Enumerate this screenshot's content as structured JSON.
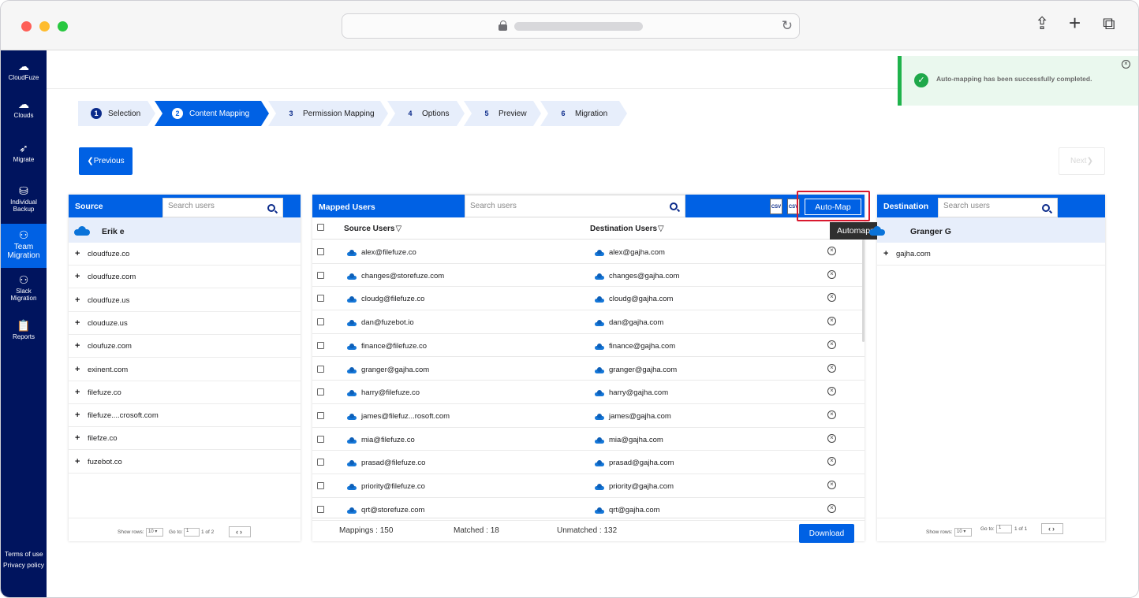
{
  "sidebar": {
    "brand": "CloudFuze",
    "items": [
      {
        "label": "Clouds",
        "icon": "cloud-icon"
      },
      {
        "label": "Migrate",
        "icon": "rocket-icon"
      },
      {
        "label_1": "Individual",
        "label_2": "Backup",
        "icon": "database-icon"
      },
      {
        "label_1": "Team",
        "label_2": "Migration",
        "icon": "users-icon"
      },
      {
        "label_1": "Slack",
        "label_2": "Migration",
        "icon": "users-icon"
      },
      {
        "label": "Reports",
        "icon": "clipboard-icon"
      }
    ],
    "terms": "Terms of use",
    "privacy": "Privacy policy"
  },
  "steps": [
    {
      "num": "1",
      "label": "Selection"
    },
    {
      "num": "2",
      "label": "Content Mapping"
    },
    {
      "num": "3",
      "label": "Permission Mapping"
    },
    {
      "num": "4",
      "label": "Options"
    },
    {
      "num": "5",
      "label": "Preview"
    },
    {
      "num": "6",
      "label": "Migration"
    }
  ],
  "nav": {
    "previous": "Previous",
    "next": "Next"
  },
  "toast": {
    "message": "Auto-mapping has been successfully completed."
  },
  "source": {
    "title": "Source",
    "search_placeholder": "Search users",
    "user": "Erik e",
    "domains": [
      "cloudfuze.co",
      "cloudfuze.com",
      "cloudfuze.us",
      "clouduze.us",
      "cloufuze.com",
      "exinent.com",
      "filefuze.co",
      "filefuze....crosoft.com",
      "filefze.co",
      "fuzebot.co"
    ],
    "pager": {
      "show_rows": "Show rows:",
      "rows": "10",
      "go_to": "Go to:",
      "page": "1",
      "of": "1 of 2"
    }
  },
  "mapped": {
    "title": "Mapped Users",
    "search_placeholder": "Search users",
    "csv1": "CSV",
    "csv2": "CSV",
    "automap": "Auto-Map",
    "tooltip": "Automapping",
    "col_source": "Source Users",
    "col_destination": "Destination Users",
    "rows": [
      {
        "src": "alex@filefuze.co",
        "dst": "alex@gajha.com"
      },
      {
        "src": "changes@storefuze.com",
        "dst": "changes@gajha.com"
      },
      {
        "src": "cloudg@filefuze.co",
        "dst": "cloudg@gajha.com"
      },
      {
        "src": "dan@fuzebot.io",
        "dst": "dan@gajha.com"
      },
      {
        "src": "finance@filefuze.co",
        "dst": "finance@gajha.com"
      },
      {
        "src": "granger@gajha.com",
        "dst": "granger@gajha.com"
      },
      {
        "src": "harry@filefuze.co",
        "dst": "harry@gajha.com"
      },
      {
        "src": "james@filefuz...rosoft.com",
        "dst": "james@gajha.com"
      },
      {
        "src": "mia@filefuze.co",
        "dst": "mia@gajha.com"
      },
      {
        "src": "prasad@filefuze.co",
        "dst": "prasad@gajha.com"
      },
      {
        "src": "priority@filefuze.co",
        "dst": "priority@gajha.com"
      },
      {
        "src": "qrt@storefuze.com",
        "dst": "qrt@gajha.com"
      }
    ],
    "mappings": "Mappings : 150",
    "matched": "Matched : 18",
    "unmatched": "Unmatched : 132",
    "download": "Download"
  },
  "destination": {
    "title": "Destination",
    "search_placeholder": "Search users",
    "user": "Granger G",
    "domains": [
      "gajha.com"
    ],
    "pager": {
      "show_rows": "Show rows:",
      "rows": "10",
      "go_to": "Go to:",
      "page": "1",
      "of": "1 of 1"
    }
  }
}
